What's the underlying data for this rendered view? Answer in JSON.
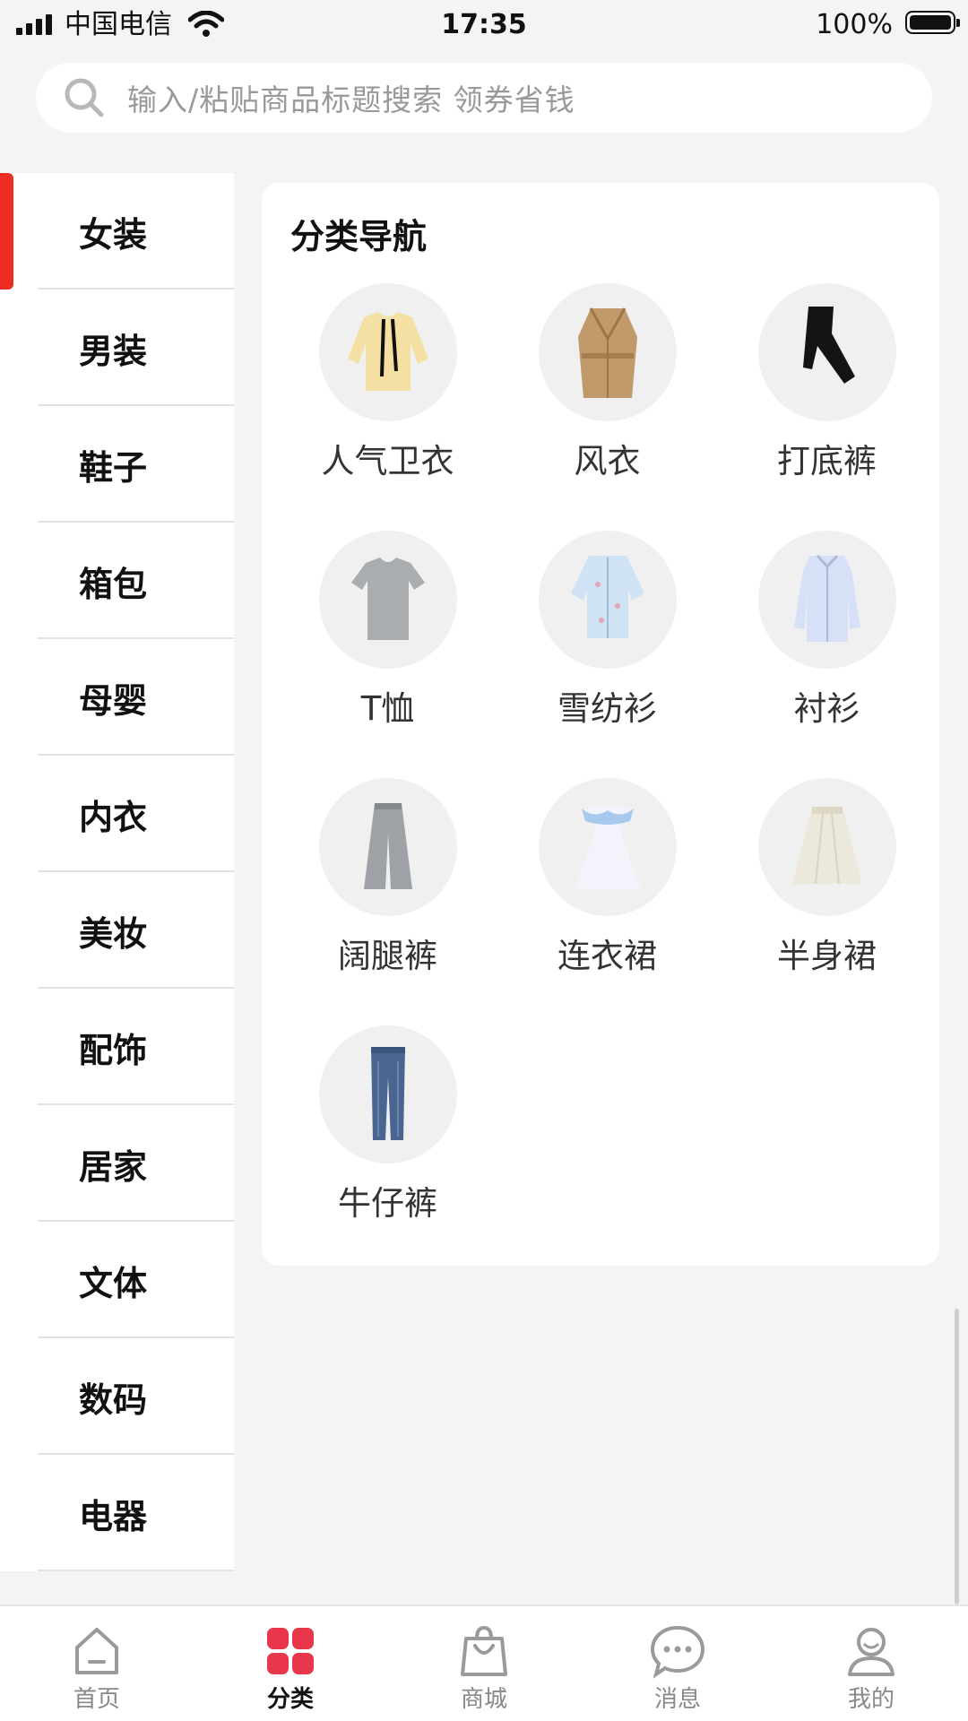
{
  "status_bar": {
    "carrier": "中国电信",
    "time": "17:35",
    "battery": "100%"
  },
  "search": {
    "placeholder": "输入/粘贴商品标题搜索 领券省钱"
  },
  "sidebar": {
    "items": [
      {
        "label": "女装",
        "active": true
      },
      {
        "label": "男装"
      },
      {
        "label": "鞋子"
      },
      {
        "label": "箱包"
      },
      {
        "label": "母婴"
      },
      {
        "label": "内衣"
      },
      {
        "label": "美妆"
      },
      {
        "label": "配饰"
      },
      {
        "label": "居家"
      },
      {
        "label": "文体"
      },
      {
        "label": "数码"
      },
      {
        "label": "电器"
      }
    ]
  },
  "content": {
    "title": "分类导航",
    "categories": [
      {
        "label": "人气卫衣",
        "icon": "hoodie"
      },
      {
        "label": "风衣",
        "icon": "trench-coat"
      },
      {
        "label": "打底裤",
        "icon": "leggings"
      },
      {
        "label": "T恤",
        "icon": "t-shirt"
      },
      {
        "label": "雪纺衫",
        "icon": "chiffon-shirt"
      },
      {
        "label": "衬衫",
        "icon": "shirt"
      },
      {
        "label": "阔腿裤",
        "icon": "wide-leg-pants"
      },
      {
        "label": "连衣裙",
        "icon": "dress"
      },
      {
        "label": "半身裙",
        "icon": "skirt"
      },
      {
        "label": "牛仔裤",
        "icon": "jeans"
      }
    ]
  },
  "tabbar": {
    "tabs": [
      {
        "label": "首页",
        "icon": "home-icon"
      },
      {
        "label": "分类",
        "icon": "category-icon",
        "active": true
      },
      {
        "label": "商城",
        "icon": "shopping-bag-icon"
      },
      {
        "label": "消息",
        "icon": "message-icon"
      },
      {
        "label": "我的",
        "icon": "profile-icon"
      }
    ]
  },
  "colors": {
    "accent": "#ee2c23",
    "category_active": "#e8374a",
    "background": "#f4f4f4"
  }
}
